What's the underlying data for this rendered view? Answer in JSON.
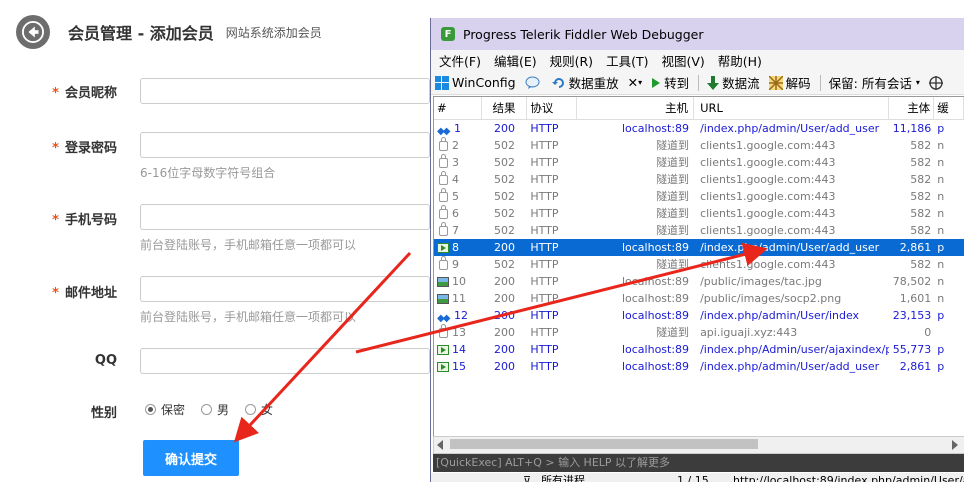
{
  "header": {
    "title": "会员管理 - 添加会员",
    "subtitle": "网站系统添加会员"
  },
  "form": {
    "required_mark": "*",
    "nickname_label": "会员昵称",
    "password_label": "登录密码",
    "password_hint": "6-16位字母数字符号组合",
    "phone_label": "手机号码",
    "phone_hint": "前台登陆账号，手机邮箱任意一项都可以",
    "email_label": "邮件地址",
    "email_hint": "前台登陆账号，手机邮箱任意一项都可以",
    "qq_label": "QQ",
    "gender_label": "性别",
    "gender_options": [
      "保密",
      "男",
      "女"
    ],
    "gender_selected": "保密",
    "submit_label": "确认提交"
  },
  "fiddler": {
    "title": "Progress Telerik Fiddler Web Debugger",
    "logo": "F",
    "menu": [
      "文件(F)",
      "编辑(E)",
      "规则(R)",
      "工具(T)",
      "视图(V)",
      "帮助(H)"
    ],
    "toolbar": {
      "winconfig": "WinConfig",
      "replay": "数据重放",
      "remove": "✕",
      "go": "转到",
      "stream": "数据流",
      "decode": "解码",
      "keep": "保留: 所有会话"
    },
    "columns": [
      "#",
      "结果",
      "协议",
      "主机",
      "URL",
      "主体",
      "缓"
    ],
    "sessions": [
      {
        "num": "1",
        "result": "200",
        "protocol": "HTTP",
        "host": "localhost:89",
        "url": "/index.php/admin/User/add_user",
        "body": "11,186",
        "ext": "p",
        "icon": "double-arrow",
        "style": "blue"
      },
      {
        "num": "2",
        "result": "502",
        "protocol": "HTTP",
        "host": "隧道到",
        "url": "clients1.google.com:443",
        "body": "582",
        "ext": "n",
        "icon": "lock",
        "style": "gray"
      },
      {
        "num": "3",
        "result": "502",
        "protocol": "HTTP",
        "host": "隧道到",
        "url": "clients1.google.com:443",
        "body": "582",
        "ext": "n",
        "icon": "lock",
        "style": "gray"
      },
      {
        "num": "4",
        "result": "502",
        "protocol": "HTTP",
        "host": "隧道到",
        "url": "clients1.google.com:443",
        "body": "582",
        "ext": "n",
        "icon": "lock",
        "style": "gray"
      },
      {
        "num": "5",
        "result": "502",
        "protocol": "HTTP",
        "host": "隧道到",
        "url": "clients1.google.com:443",
        "body": "582",
        "ext": "n",
        "icon": "lock",
        "style": "gray"
      },
      {
        "num": "6",
        "result": "502",
        "protocol": "HTTP",
        "host": "隧道到",
        "url": "clients1.google.com:443",
        "body": "582",
        "ext": "n",
        "icon": "lock",
        "style": "gray"
      },
      {
        "num": "7",
        "result": "502",
        "protocol": "HTTP",
        "host": "隧道到",
        "url": "clients1.google.com:443",
        "body": "582",
        "ext": "n",
        "icon": "lock",
        "style": "gray"
      },
      {
        "num": "8",
        "result": "200",
        "protocol": "HTTP",
        "host": "localhost:89",
        "url": "/index.php/admin/User/add_user",
        "body": "2,861",
        "ext": "p",
        "icon": "arrow",
        "style": "sel"
      },
      {
        "num": "9",
        "result": "502",
        "protocol": "HTTP",
        "host": "隧道到",
        "url": "clients1.google.com:443",
        "body": "582",
        "ext": "n",
        "icon": "lock",
        "style": "gray"
      },
      {
        "num": "10",
        "result": "200",
        "protocol": "HTTP",
        "host": "localhost:89",
        "url": "/public/images/tac.jpg",
        "body": "78,502",
        "ext": "n",
        "icon": "image",
        "style": "gray"
      },
      {
        "num": "11",
        "result": "200",
        "protocol": "HTTP",
        "host": "localhost:89",
        "url": "/public/images/socp2.png",
        "body": "1,601",
        "ext": "n",
        "icon": "image",
        "style": "gray"
      },
      {
        "num": "12",
        "result": "200",
        "protocol": "HTTP",
        "host": "localhost:89",
        "url": "/index.php/admin/User/index",
        "body": "23,153",
        "ext": "p",
        "icon": "double-arrow",
        "style": "blue"
      },
      {
        "num": "13",
        "result": "200",
        "protocol": "HTTP",
        "host": "隧道到",
        "url": "api.iguaji.xyz:443",
        "body": "0",
        "ext": "",
        "icon": "lock",
        "style": "gray"
      },
      {
        "num": "14",
        "result": "200",
        "protocol": "HTTP",
        "host": "localhost:89",
        "url": "/index.php/Admin/user/ajaxindex/p/1",
        "body": "55,773",
        "ext": "p",
        "icon": "arrow",
        "style": "blue"
      },
      {
        "num": "15",
        "result": "200",
        "protocol": "HTTP",
        "host": "localhost:89",
        "url": "/index.php/admin/User/add_user",
        "body": "2,861",
        "ext": "p",
        "icon": "arrow",
        "style": "blue"
      }
    ],
    "quickexec": "[QuickExec] ALT+Q > 输入 HELP 以了解更多",
    "status": {
      "process_filter": "所有进程",
      "count": "1 / 15",
      "url": "http://localhost:89/index.php/admin/User/add"
    }
  },
  "colors": {
    "accent": "#1e90ff",
    "required": "#e8531d",
    "selection": "#0a6ad4",
    "annotation_arrow": "#e8261c"
  }
}
